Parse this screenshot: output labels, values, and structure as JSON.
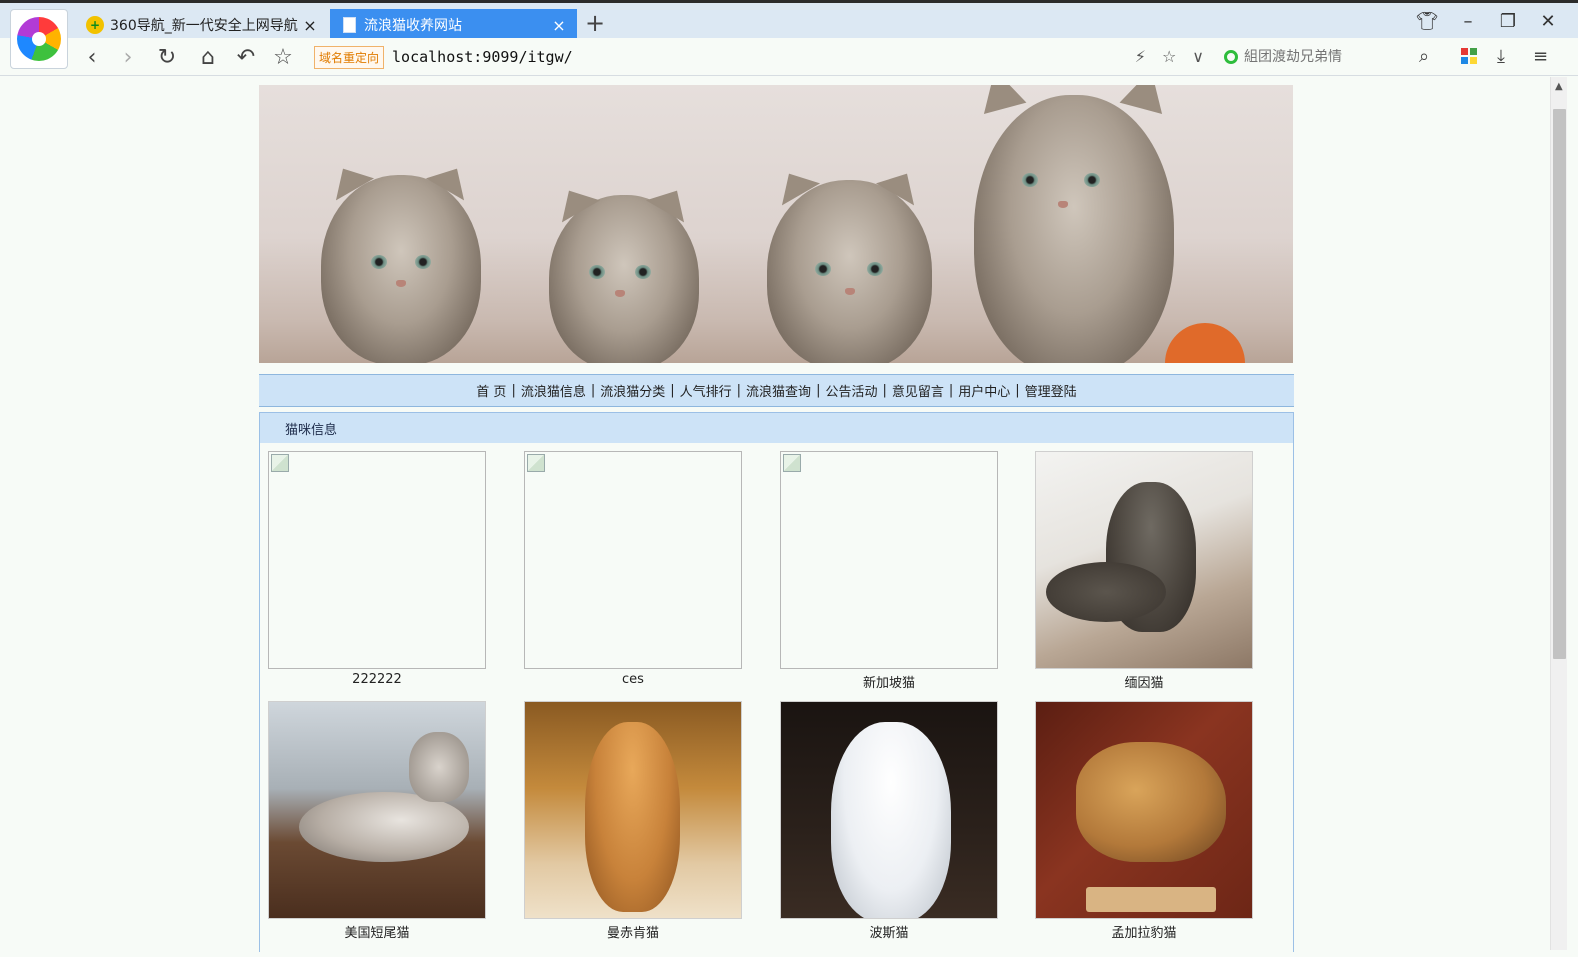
{
  "browser": {
    "tabs": [
      {
        "title": "360导航_新一代安全上网导航",
        "favicon": "plus-shield-icon",
        "active": false
      },
      {
        "title": "流浪猫收养网站",
        "favicon": "page-icon",
        "active": true
      }
    ],
    "redirect_badge": "域名重定向",
    "url": "localhost:9099/itgw/",
    "search_placeholder": "組团渡劫兄弟情"
  },
  "site": {
    "banner_alt": "banner-kittens",
    "nav": [
      "首 页",
      "流浪猫信息",
      "流浪猫分类",
      "人气排行",
      "流浪猫查询",
      "公告活动",
      "意见留言",
      "用户中心",
      "管理登陆"
    ],
    "section_title": "猫咪信息",
    "cats": [
      {
        "name": "222222",
        "image": "broken-image-icon"
      },
      {
        "name": "ces",
        "image": "broken-image-icon"
      },
      {
        "name": "新加坡猫",
        "image": "broken-image-icon"
      },
      {
        "name": "缅因猫",
        "image": "maine-coon-photo"
      },
      {
        "name": "美国短尾猫",
        "image": "american-bobtail-photo"
      },
      {
        "name": "曼赤肯猫",
        "image": "munchkin-photo"
      },
      {
        "name": "波斯猫",
        "image": "persian-photo"
      },
      {
        "name": "孟加拉豹猫",
        "image": "bengal-photo"
      }
    ]
  },
  "colors": {
    "active_tab": "#3b8ff0",
    "nav_bar": "#cde3f7",
    "page_bg": "#f7fbf7"
  }
}
